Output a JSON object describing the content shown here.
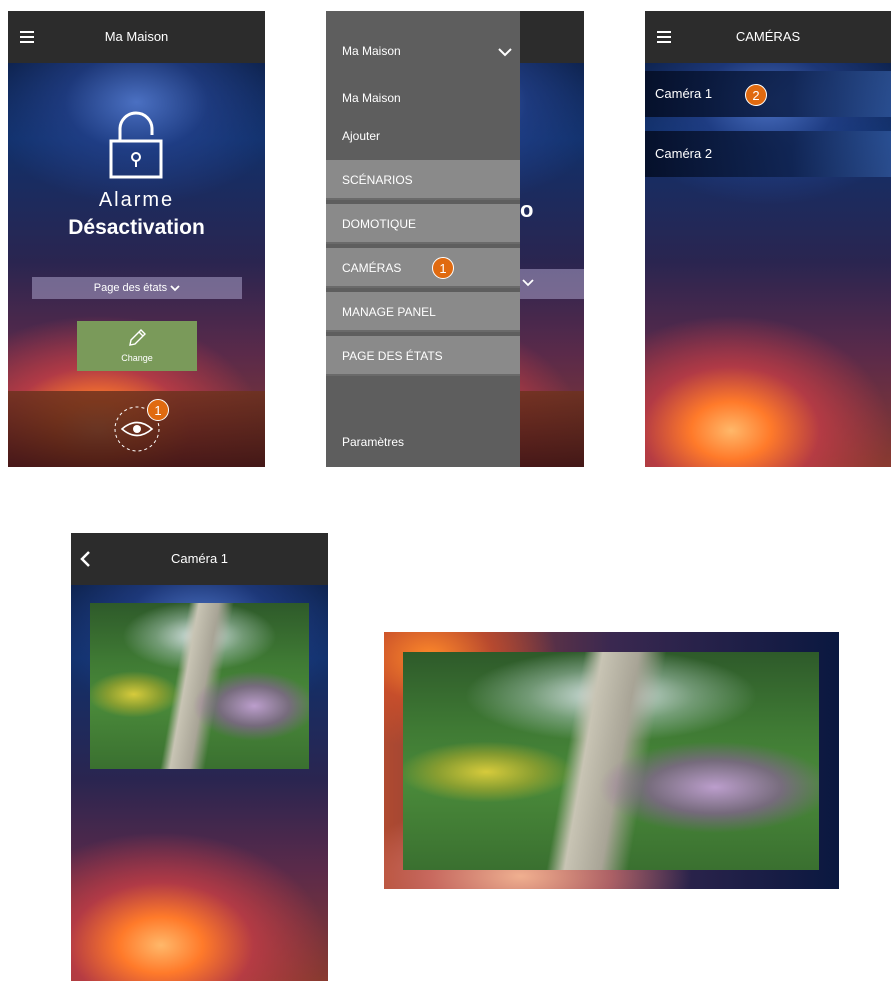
{
  "screen1": {
    "title": "Ma Maison",
    "alarm_line1": "Alarme",
    "alarm_line2": "Désactivation",
    "status_select": "Page des états",
    "change_label": "Change",
    "badge": "1",
    "icons": [
      "menu-icon",
      "padlock-icon",
      "chevron-down-icon",
      "pencil-icon",
      "eye-icon"
    ]
  },
  "screen2": {
    "home_selector": "Ma Maison",
    "home_item": "Ma Maison",
    "add_item": "Ajouter",
    "menu_items": [
      "SCÉNARIOS",
      "DOMOTIQUE",
      "CAMÉRAS",
      "MANAGE PANEL",
      "PAGE DES ÉTATS"
    ],
    "settings": "Paramètres",
    "badge": "1",
    "partial_letter": "o"
  },
  "screen3": {
    "title": "CAMÉRAS",
    "cameras": [
      "Caméra 1",
      "Caméra 2"
    ],
    "badge": "2"
  },
  "screen4": {
    "title": "Caméra 1"
  },
  "colors": {
    "topbar": "#2c2c2c",
    "badge": "#e06a10",
    "menu_panel": "#5e5e5e",
    "menu_item": "#8a8a8a",
    "change_button": "#7a9a5a"
  }
}
